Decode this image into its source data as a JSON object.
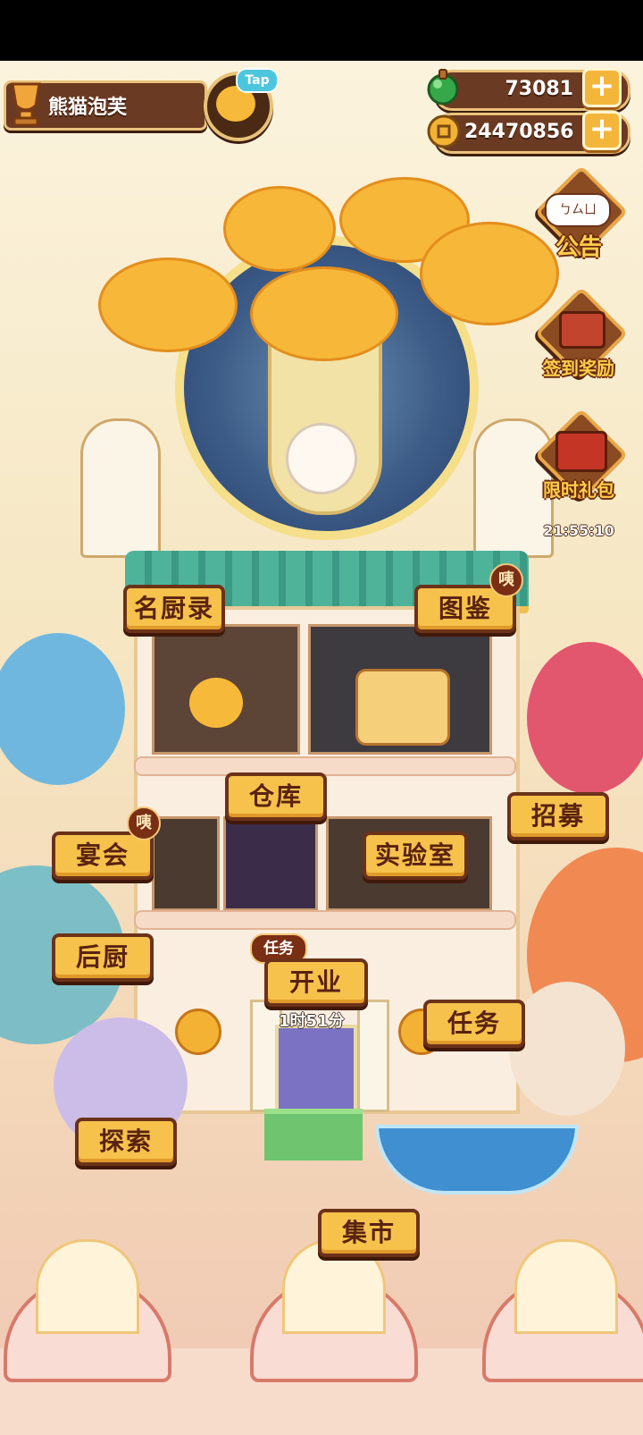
{
  "player": {
    "name": "熊猫泡芙",
    "tap_badge": "Tap"
  },
  "resources": {
    "jade": "73081",
    "coins": "24470856"
  },
  "side_menu": {
    "announcement": "公告",
    "announcement_bubble": "ㄅㄙㄩ",
    "checkin": "签到奖励",
    "gift": "限时礼包",
    "gift_timer": "21:55:10"
  },
  "building": {
    "chef_records": "名厨录",
    "catalog": "图鉴",
    "catalog_badge": "咦",
    "warehouse": "仓库",
    "recruit": "招募",
    "banquet": "宴会",
    "banquet_badge": "咦",
    "lab": "实验室",
    "back_kitchen": "后厨",
    "task_badge": "任务",
    "open_business": "开业",
    "open_countdown": "1时51分",
    "tasks": "任务",
    "explore": "探索",
    "market": "集市"
  },
  "colors": {
    "wood_dark": "#6b3a22",
    "gold_border": "#e9c27a",
    "sign_fill": "#f6c24c",
    "sign_text": "#5a2210",
    "roof_green": "#4fb39a",
    "accent_cyan": "#4cc6dd"
  }
}
